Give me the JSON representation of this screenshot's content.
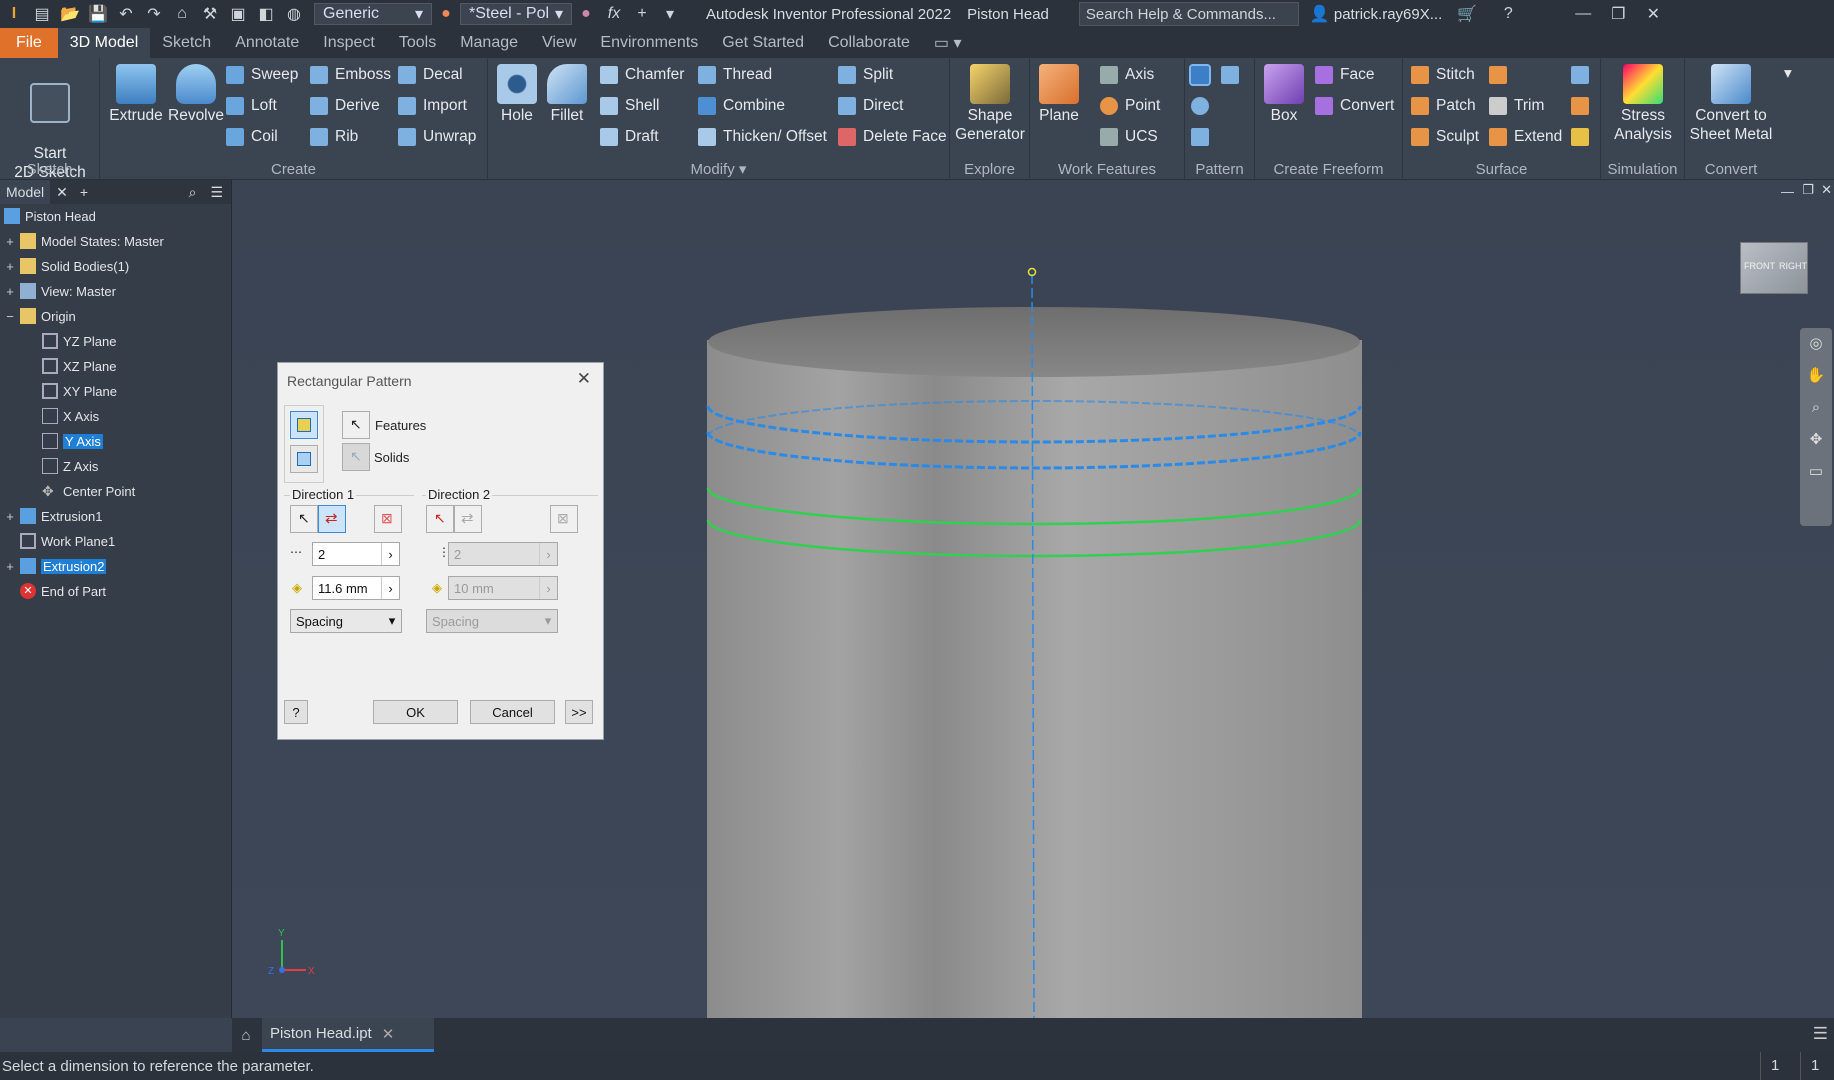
{
  "titlebar": {
    "app_title": "Autodesk Inventor Professional 2022",
    "doc_title": "Piston Head",
    "appearance_select": "Generic",
    "material_select": "*Steel - Pol",
    "search_placeholder": "Search Help & Commands...",
    "user": "patrick.ray69X..."
  },
  "tabs": [
    "File",
    "3D Model",
    "Sketch",
    "Annotate",
    "Inspect",
    "Tools",
    "Manage",
    "View",
    "Environments",
    "Get Started",
    "Collaborate"
  ],
  "ribbon": {
    "sketch": {
      "group": "Sketch",
      "start": "Start\n2D Sketch"
    },
    "create": {
      "group": "Create",
      "extrude": "Extrude",
      "revolve": "Revolve",
      "sweep": "Sweep",
      "loft": "Loft",
      "coil": "Coil",
      "emboss": "Emboss",
      "derive": "Derive",
      "rib": "Rib",
      "decal": "Decal",
      "import": "Import",
      "unwrap": "Unwrap"
    },
    "modify": {
      "group": "Modify",
      "hole": "Hole",
      "fillet": "Fillet",
      "chamfer": "Chamfer",
      "shell": "Shell",
      "draft": "Draft",
      "thread": "Thread",
      "combine": "Combine",
      "thicken": "Thicken/ Offset",
      "split": "Split",
      "direct": "Direct",
      "delete_face": "Delete Face"
    },
    "explore": {
      "group": "Explore",
      "shape": "Shape\nGenerator"
    },
    "work": {
      "group": "Work Features",
      "plane": "Plane",
      "axis": "Axis",
      "point": "Point",
      "ucs": "UCS"
    },
    "pattern": {
      "group": "Pattern"
    },
    "freeform": {
      "group": "Create Freeform",
      "box": "Box",
      "face": "Face",
      "convert": "Convert"
    },
    "surface": {
      "group": "Surface",
      "stitch": "Stitch",
      "patch": "Patch",
      "sculpt": "Sculpt",
      "trim": "Trim",
      "extend": "Extend"
    },
    "simulation": {
      "group": "Simulation",
      "stress": "Stress\nAnalysis"
    },
    "convert": {
      "group": "Convert",
      "sheet": "Convert to\nSheet Metal"
    }
  },
  "browser": {
    "tab": "Model",
    "nodes": [
      {
        "label": "Piston Head"
      },
      {
        "label": "Model States: Master"
      },
      {
        "label": "Solid Bodies(1)"
      },
      {
        "label": "View: Master"
      },
      {
        "label": "Origin"
      },
      {
        "label": "YZ Plane"
      },
      {
        "label": "XZ Plane"
      },
      {
        "label": "XY Plane"
      },
      {
        "label": "X Axis"
      },
      {
        "label": "Y Axis"
      },
      {
        "label": "Z Axis"
      },
      {
        "label": "Center Point"
      },
      {
        "label": "Extrusion1"
      },
      {
        "label": "Work Plane1"
      },
      {
        "label": "Extrusion2"
      },
      {
        "label": "End of Part"
      }
    ]
  },
  "viewcube": {
    "front": "FRONT",
    "right": "RIGHT"
  },
  "triad": {
    "x": "X",
    "y": "Y",
    "z": "Z"
  },
  "dialog": {
    "title": "Rectangular Pattern",
    "features": "Features",
    "solids": "Solids",
    "dir1_label": "Direction 1",
    "dir2_label": "Direction 2",
    "dir1_count": "2",
    "dir1_spacing": "11.6 mm",
    "dir1_mode": "Spacing",
    "dir2_count": "2",
    "dir2_spacing": "10 mm",
    "dir2_mode": "Spacing",
    "ok": "OK",
    "cancel": "Cancel",
    "more": ">>"
  },
  "doc_tab": "Piston Head.ipt",
  "status": {
    "message": "Select a dimension to reference the parameter.",
    "count1": "1",
    "count2": "1"
  }
}
